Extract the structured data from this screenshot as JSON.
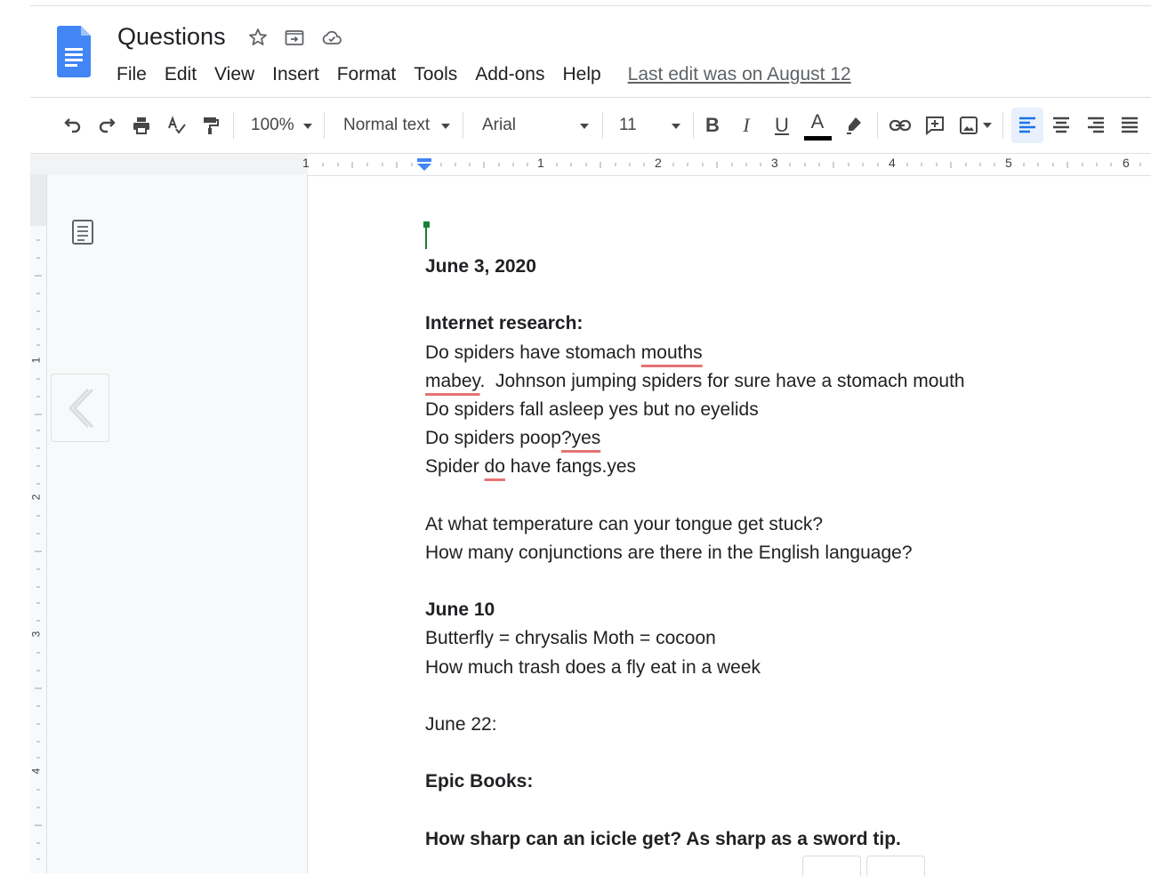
{
  "doc": {
    "title": "Questions",
    "last_edit": "Last edit was on August 12"
  },
  "menu": [
    "File",
    "Edit",
    "View",
    "Insert",
    "Format",
    "Tools",
    "Add-ons",
    "Help"
  ],
  "toolbar": {
    "zoom": "100%",
    "style": "Normal text",
    "font": "Arial",
    "font_size": "11",
    "bold": "B",
    "italic": "I",
    "underline": "U",
    "text_color_letter": "A",
    "text_color": "#000000"
  },
  "ruler": {
    "h_numbers": [
      "1",
      "1",
      "2",
      "3",
      "4",
      "5",
      "6"
    ],
    "v_numbers": [
      "1",
      "2",
      "3",
      "4"
    ]
  },
  "document_lines": [
    {
      "text": "June 3, 2020",
      "bold": true
    },
    {
      "text": ""
    },
    {
      "text": "Internet research:",
      "bold": true
    },
    {
      "text": "Do spiders have stomach mouths "
    },
    {
      "text": "mabey.  Johnson jumping spiders for sure have a stomach mouth"
    },
    {
      "text": "Do spiders fall asleep yes but no eyelids"
    },
    {
      "text": "Do spiders poop?yes"
    },
    {
      "text": "Spider do have fangs.yes"
    },
    {
      "text": ""
    },
    {
      "text": "At what temperature can your tongue get stuck?"
    },
    {
      "text": "How many conjunctions are there in the English language?"
    },
    {
      "text": ""
    },
    {
      "text": "June 10",
      "bold": true
    },
    {
      "text": "Butterfly = chrysalis  Moth = cocoon"
    },
    {
      "text": "How much trash does a fly eat in a week"
    },
    {
      "text": ""
    },
    {
      "text": "June 22:"
    },
    {
      "text": ""
    },
    {
      "text": "Epic Books:",
      "bold": true
    },
    {
      "text": ""
    },
    {
      "text": "How sharp can an icicle get? As sharp as a sword tip.",
      "bold": true
    }
  ],
  "spellcheck_words": [
    "mouths ",
    "mabey",
    "?yes",
    "do"
  ],
  "colors": {
    "accent": "#4285f4",
    "cursor": "#188038",
    "spell_underline": "#e57373"
  }
}
